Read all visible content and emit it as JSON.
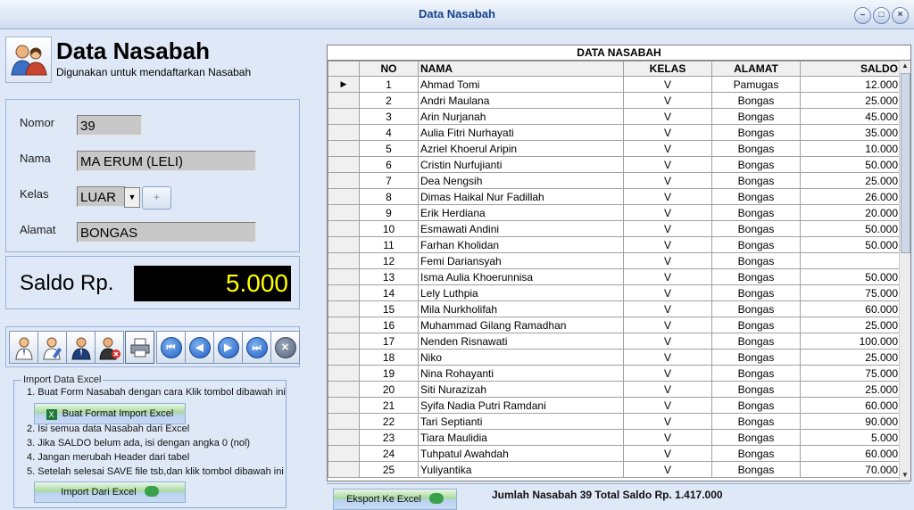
{
  "window": {
    "title": "Data Nasabah",
    "buttons": [
      "–",
      "□",
      "×"
    ]
  },
  "header": {
    "icon": "users-icon",
    "title": "Data Nasabah",
    "subtitle": "Digunakan untuk mendaftarkan Nasabah"
  },
  "form": {
    "nomor_label": "Nomor",
    "nomor_value": "39",
    "nama_label": "Nama",
    "nama_value": "MA ERUM (LELI)",
    "kelas_label": "Kelas",
    "kelas_value": "LUAR",
    "kelas_add": "+",
    "alamat_label": "Alamat",
    "alamat_value": "BONGAS"
  },
  "saldo": {
    "label": "Saldo Rp.",
    "value": "5.000"
  },
  "toolbar": {
    "items": [
      "add-user-icon",
      "edit-user-icon",
      "save-user-icon",
      "delete-user-icon",
      "print-icon"
    ],
    "nav": [
      "first-icon",
      "prev-icon",
      "next-icon",
      "last-icon",
      "close-icon"
    ],
    "nav_glyphs": [
      "⏮",
      "◀",
      "▶",
      "⏭",
      "✕"
    ]
  },
  "import": {
    "legend": "Import Data Excel",
    "step1": "1. Buat Form Nasabah dengan cara Klik tombol dibawah ini",
    "btn_format": "Buat Format Import Excel",
    "step2": "2. Isi semua data Nasabah dari Excel",
    "step3": "3. Jika SALDO belum ada, isi dengan angka 0 (nol)",
    "step4": "4. Jangan merubah Header dari tabel",
    "step5": "5. Setelah selesai SAVE file tsb,dan klik tombol dibawah ini",
    "btn_import": "Import Dari Excel"
  },
  "grid": {
    "caption": "DATA NASABAH",
    "columns": [
      "NO",
      "NAMA",
      "KELAS",
      "ALAMAT",
      "SALDO"
    ],
    "row_indicator": "▶",
    "rows": [
      [
        "1",
        "Ahmad Tomi",
        "V",
        "Pamugas",
        "12.000"
      ],
      [
        "2",
        "Andri Maulana",
        "V",
        "Bongas",
        "25.000"
      ],
      [
        "3",
        "Arin Nurjanah",
        "V",
        "Bongas",
        "45.000"
      ],
      [
        "4",
        "Aulia Fitri Nurhayati",
        "V",
        "Bongas",
        "35.000"
      ],
      [
        "5",
        "Azriel Khoerul Aripin",
        "V",
        "Bongas",
        "10.000"
      ],
      [
        "6",
        "Cristin Nurfujianti",
        "V",
        "Bongas",
        "50.000"
      ],
      [
        "7",
        "Dea Nengsih",
        "V",
        "Bongas",
        "25.000"
      ],
      [
        "8",
        "Dimas Haikal Nur Fadillah",
        "V",
        "Bongas",
        "26.000"
      ],
      [
        "9",
        "Erik Herdiana",
        "V",
        "Bongas",
        "20.000"
      ],
      [
        "10",
        "Esmawati Andini",
        "V",
        "Bongas",
        "50.000"
      ],
      [
        "11",
        "Farhan Kholidan",
        "V",
        "Bongas",
        "50.000"
      ],
      [
        "12",
        "Femi Dariansyah",
        "V",
        "Bongas",
        ""
      ],
      [
        "13",
        "Isma Aulia Khoerunnisa",
        "V",
        "Bongas",
        "50.000"
      ],
      [
        "14",
        "Lely Luthpia",
        "V",
        "Bongas",
        "75.000"
      ],
      [
        "15",
        "Mila Nurkholifah",
        "V",
        "Bongas",
        "60.000"
      ],
      [
        "16",
        "Muhammad Gilang Ramadhan",
        "V",
        "Bongas",
        "25.000"
      ],
      [
        "17",
        "Nenden Risnawati",
        "V",
        "Bongas",
        "100.000"
      ],
      [
        "18",
        "Niko",
        "V",
        "Bongas",
        "25.000"
      ],
      [
        "19",
        "Nina Rohayanti",
        "V",
        "Bongas",
        "75.000"
      ],
      [
        "20",
        "Siti Nurazizah",
        "V",
        "Bongas",
        "25.000"
      ],
      [
        "21",
        "Syifa Nadia Putri Ramdani",
        "V",
        "Bongas",
        "60.000"
      ],
      [
        "22",
        "Tari Septianti",
        "V",
        "Bongas",
        "90.000"
      ],
      [
        "23",
        "Tiara Maulidia",
        "V",
        "Bongas",
        "5.000"
      ],
      [
        "24",
        "Tuhpatul Awahdah",
        "V",
        "Bongas",
        "60.000"
      ],
      [
        "25",
        "Yuliyantika",
        "V",
        "Bongas",
        "70.000"
      ]
    ]
  },
  "footer": {
    "export_label": "Eksport Ke Excel",
    "summary": "Jumlah Nasabah 39 Total Saldo Rp. 1.417.000"
  }
}
